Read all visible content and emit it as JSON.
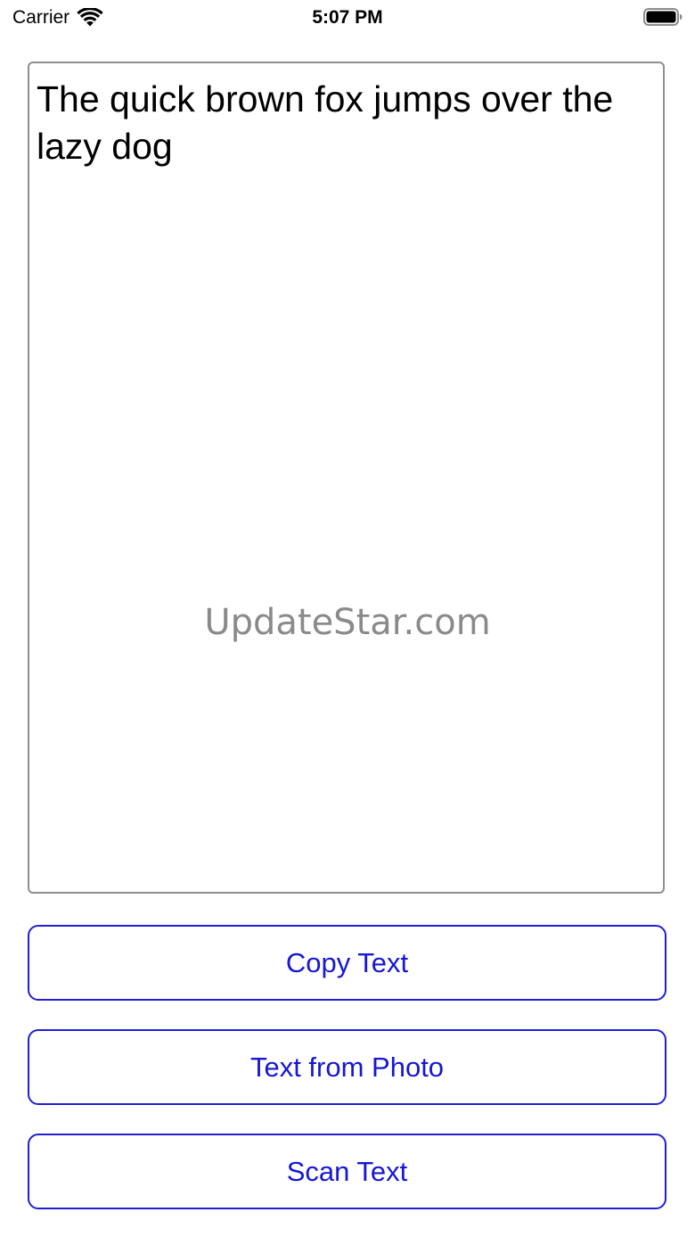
{
  "status_bar": {
    "carrier": "Carrier",
    "time": "5:07 PM",
    "wifi_icon": "wifi-icon",
    "battery_icon": "battery-icon"
  },
  "text_view": {
    "value": "The quick brown fox jumps over the lazy dog"
  },
  "watermark": {
    "text": "UpdateStar.com"
  },
  "buttons": {
    "copy_text": "Copy Text",
    "text_from_photo": "Text from Photo",
    "scan_text": "Scan Text"
  },
  "colors": {
    "accent": "#1717d4",
    "border": "#8e8e93",
    "watermark": "#8a8a8a"
  }
}
